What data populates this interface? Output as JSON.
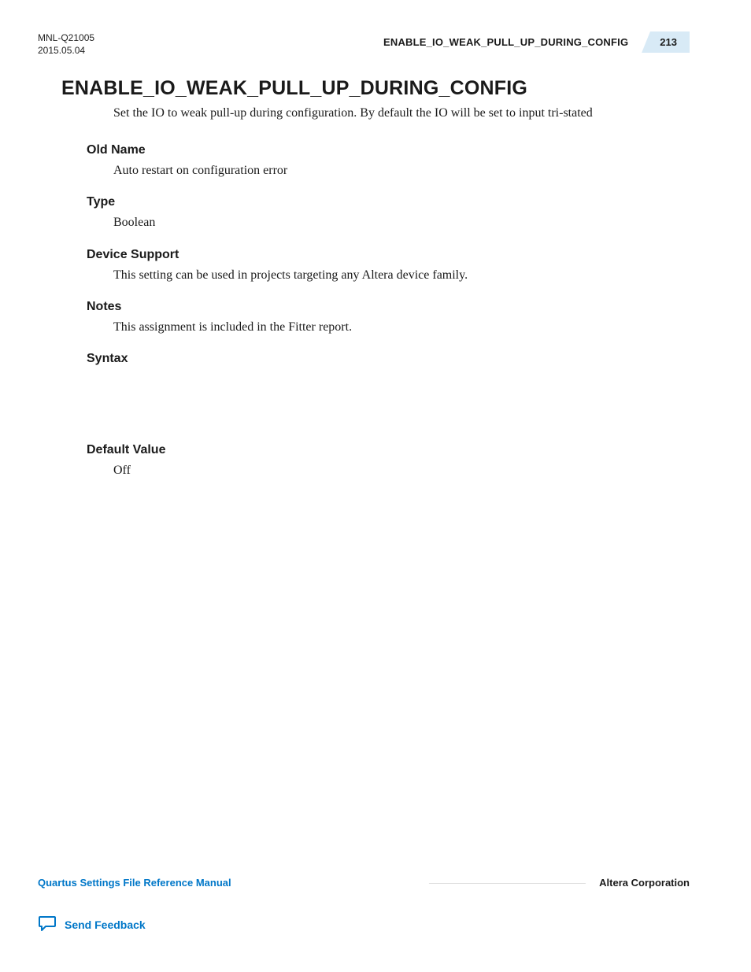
{
  "header": {
    "doc_id": "MNL-Q21005",
    "date": "2015.05.04",
    "running_title": "ENABLE_IO_WEAK_PULL_UP_DURING_CONFIG",
    "page_number": "213"
  },
  "title": "ENABLE_IO_WEAK_PULL_UP_DURING_CONFIG",
  "intro": "Set the IO to weak pull-up during configuration. By default the IO will be set to input tri-stated",
  "sections": {
    "old_name": {
      "heading": "Old Name",
      "body": "Auto restart on configuration error"
    },
    "type": {
      "heading": "Type",
      "body": "Boolean"
    },
    "device_support": {
      "heading": "Device Support",
      "body": "This setting can be used in projects targeting any Altera device family."
    },
    "notes": {
      "heading": "Notes",
      "body": "This assignment is included in the Fitter report."
    },
    "syntax": {
      "heading": "Syntax",
      "body": ""
    },
    "default_value": {
      "heading": "Default Value",
      "body": "Off"
    }
  },
  "footer": {
    "manual_name": "Quartus Settings File Reference Manual",
    "company": "Altera Corporation",
    "feedback_label": "Send Feedback"
  }
}
